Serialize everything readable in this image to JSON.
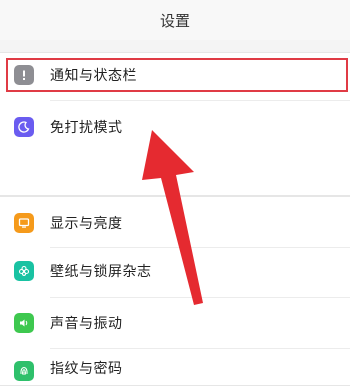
{
  "header": {
    "title": "设置"
  },
  "group1": {
    "items": [
      {
        "label": "通知与状态栏",
        "icon": "notification-icon",
        "color": "#8e8e93"
      },
      {
        "label": "免打扰模式",
        "icon": "moon-icon",
        "color": "#6a5cf0"
      }
    ]
  },
  "group2": {
    "items": [
      {
        "label": "显示与亮度",
        "icon": "display-icon",
        "color": "#f59a1b"
      },
      {
        "label": "壁纸与锁屏杂志",
        "icon": "flower-icon",
        "color": "#19c2a2"
      },
      {
        "label": "声音与振动",
        "icon": "speaker-icon",
        "color": "#3ec84f"
      },
      {
        "label": "指纹与密码",
        "icon": "fingerprint-icon",
        "color": "#2ec06b"
      }
    ]
  },
  "annotation": {
    "color": "#e03b45"
  }
}
